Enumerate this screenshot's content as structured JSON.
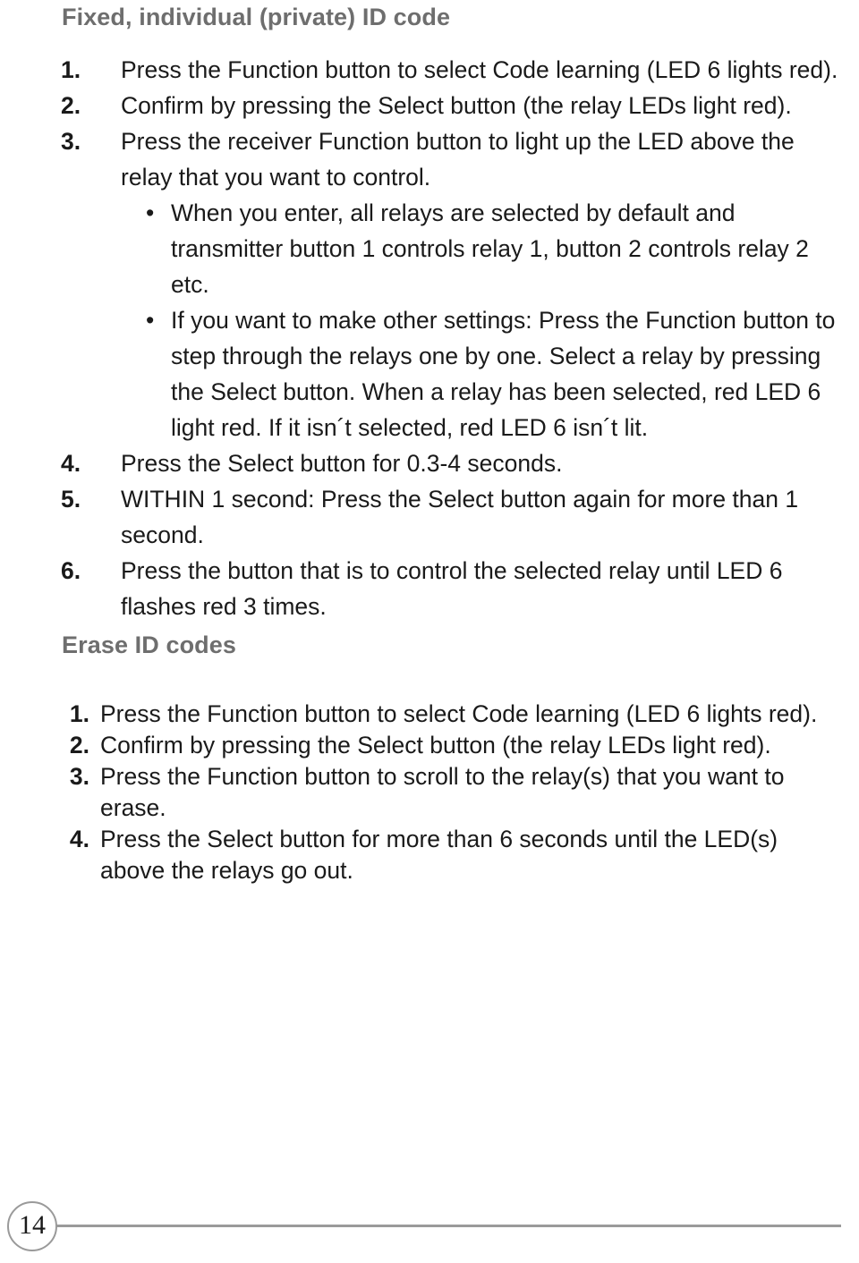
{
  "page": {
    "number": "14",
    "footer_rule": true
  },
  "sections": [
    {
      "heading": "Fixed, individual (private) ID code",
      "items": [
        {
          "num": "1.",
          "text": "Press the Function button to select Code learning (LED 6 lights red)."
        },
        {
          "num": "2.",
          "text": "Confirm by pressing the Select button (the relay LEDs light red)."
        },
        {
          "num": "3.",
          "text": "Press the receiver Function button to light up the LED above the relay that you want to control.",
          "bullets": [
            {
              "dot": "•",
              "text": "When you enter, all relays are selected by default and transmitter button 1 controls relay 1, button 2 controls relay 2 etc."
            },
            {
              "dot": "•",
              "text": "If you want to make other settings: Press the Function button to step through the relays one by one. Select a relay by pressing the Select button. When a relay has been selected, red LED 6 light red. If it isn´t selected, red LED 6 isn´t lit."
            }
          ]
        },
        {
          "num": "4.",
          "text": "Press the Select button for 0.3-4 seconds."
        },
        {
          "num": "5.",
          "text": "WITHIN 1 second: Press the Select button again for more than 1 second."
        },
        {
          "num": "6.",
          "text": "Press the button that is to control the selected relay until LED 6 flashes red 3 times."
        }
      ]
    },
    {
      "heading": "Erase ID codes",
      "items": [
        {
          "num": "1.",
          "text": "Press the Function button to select Code learning (LED 6 lights red)."
        },
        {
          "num": "2.",
          "text": "Confirm by pressing the Select button (the relay LEDs light red)."
        },
        {
          "num": "3.",
          "text": "Press the Function button to scroll to the relay(s) that you want to erase."
        },
        {
          "num": "4.",
          "text": "Press the Select button for more than 6 seconds until the LED(s) above the relays go out."
        }
      ]
    }
  ],
  "colors": {
    "heading_gray": "#6e6e6e",
    "body_black": "#1a1a1a",
    "rule_gray": "#9a9a9a"
  }
}
